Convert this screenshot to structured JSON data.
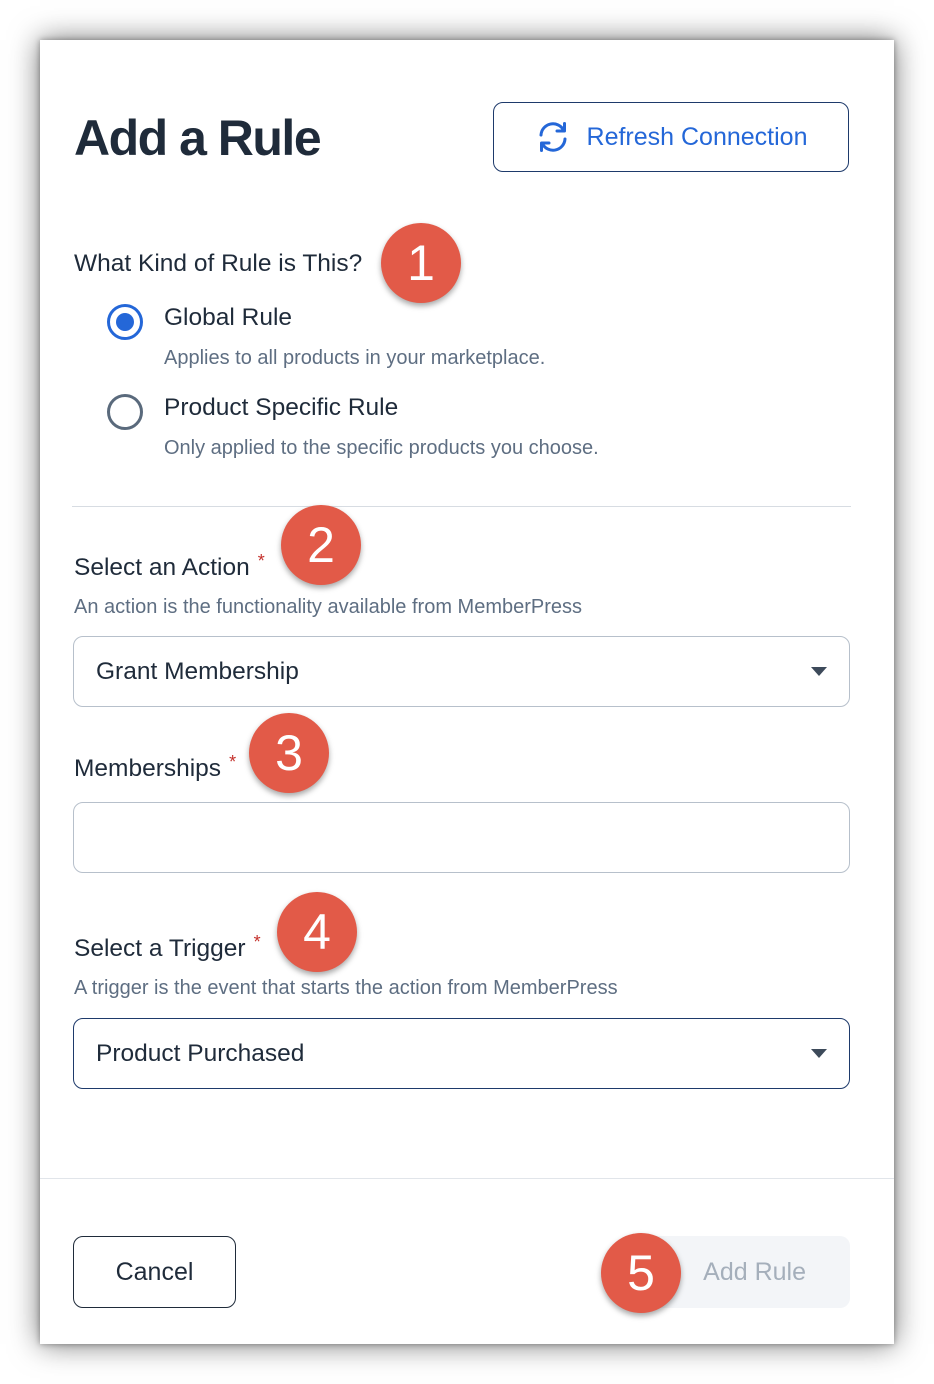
{
  "modal": {
    "title": "Add a Rule",
    "refresh_button": {
      "label": "Refresh Connection",
      "icon": "refresh-icon"
    }
  },
  "rule_type": {
    "question": "What Kind of Rule is This?",
    "options": [
      {
        "label": "Global Rule",
        "description": "Applies to all products in your marketplace.",
        "selected": true
      },
      {
        "label": "Product Specific Rule",
        "description": "Only applied to the specific products you choose.",
        "selected": false
      }
    ]
  },
  "action": {
    "label": "Select an Action",
    "required_marker": "*",
    "help": "An action is the functionality available from MemberPress",
    "value": "Grant Membership"
  },
  "memberships": {
    "label": "Memberships",
    "required_marker": "*",
    "value": ""
  },
  "trigger": {
    "label": "Select a Trigger",
    "required_marker": "*",
    "help": "A trigger is the event that starts the action from MemberPress",
    "value": "Product Purchased"
  },
  "footer": {
    "cancel_label": "Cancel",
    "add_label": "Add Rule"
  },
  "annotations": [
    "1",
    "2",
    "3",
    "4",
    "5"
  ],
  "colors": {
    "accent": "#2467d8",
    "badge": "#e25a48",
    "required": "#c4302b",
    "text": "#1f2b3a"
  }
}
